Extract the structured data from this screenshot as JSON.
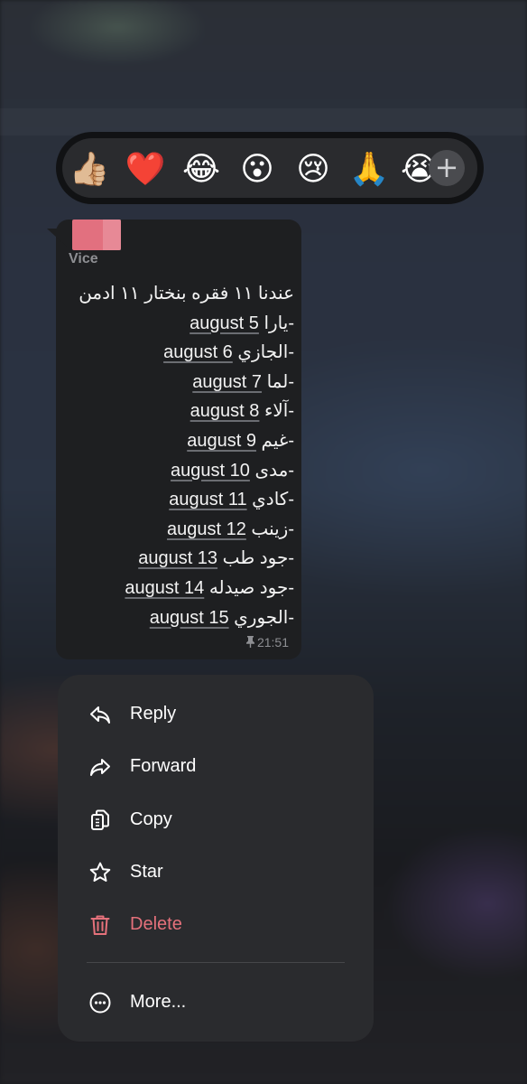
{
  "reactions": {
    "emojis": [
      "👍🏼",
      "❤️",
      "😂",
      "😮",
      "😢",
      "🙏",
      "😭"
    ],
    "add_label": "+"
  },
  "message": {
    "sender": "Vice",
    "lines": [
      {
        "text": "عندنا ١١ فقره بنختار ١١ ادمن",
        "date": ""
      },
      {
        "text": "-يارا ",
        "date": "august 5"
      },
      {
        "text": "-الجازي ",
        "date": "august 6"
      },
      {
        "text": "-لما ",
        "date": "august 7"
      },
      {
        "text": "-آلاء ",
        "date": "august 8"
      },
      {
        "text": "-غيم ",
        "date": "august 9"
      },
      {
        "text": "-مدى ",
        "date": "august 10"
      },
      {
        "text": "-كادي ",
        "date": "august 11"
      },
      {
        "text": "-زينب ",
        "date": "august 12"
      },
      {
        "text": "-جود طب ",
        "date": "august 13"
      },
      {
        "text": "-جود صيدله ",
        "date": "august 14"
      },
      {
        "text": "-الجوري ",
        "date": "august 15"
      }
    ],
    "time": "21:51",
    "pinned_icon": "pin-icon"
  },
  "menu": {
    "items": [
      {
        "label": "Reply",
        "icon": "reply-icon"
      },
      {
        "label": "Forward",
        "icon": "forward-icon"
      },
      {
        "label": "Copy",
        "icon": "copy-icon"
      },
      {
        "label": "Star",
        "icon": "star-icon"
      },
      {
        "label": "Delete",
        "icon": "trash-icon"
      },
      {
        "label": "More...",
        "icon": "more-icon"
      }
    ],
    "danger_color": "#e5717b"
  }
}
